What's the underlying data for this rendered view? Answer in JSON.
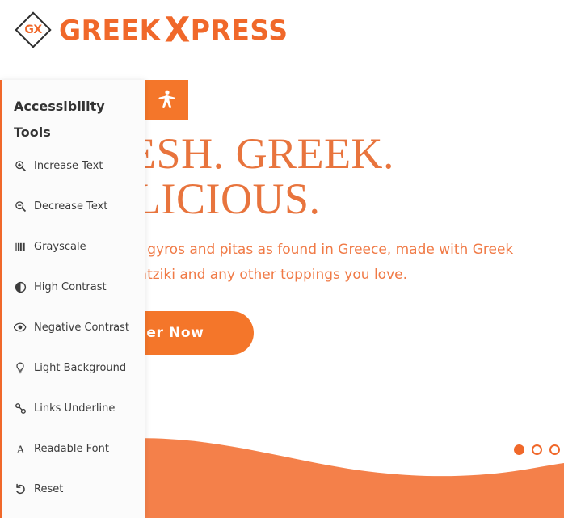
{
  "brand": {
    "logo_mark_text": "GX",
    "logo_word_1": "GREEK",
    "logo_word_2_x": "X",
    "logo_word_2_rest": "PRESS",
    "primary_color": "#f0682a",
    "button_color": "#f4762a",
    "heading_color": "#e8743d"
  },
  "hero": {
    "heading": "FRESH. GREEK.\nDELICIOUS.",
    "subtext": "Authentic gyros and pitas as found in Greece, made with Greek yogurt tzatziki and any other toppings you love.",
    "cta_label": "Order Now",
    "carousel": {
      "dots": [
        {
          "label": "slide-1",
          "active": true
        },
        {
          "label": "slide-2",
          "active": false
        },
        {
          "label": "slide-3",
          "active": false
        }
      ]
    }
  },
  "accessibility": {
    "toggle_icon": "accessibility-person-icon",
    "title": "Accessibility Tools",
    "items": [
      {
        "label": "Increase Text",
        "icon": "zoom-in-icon"
      },
      {
        "label": "Decrease Text",
        "icon": "zoom-out-icon"
      },
      {
        "label": "Grayscale",
        "icon": "grayscale-bars-icon"
      },
      {
        "label": "High Contrast",
        "icon": "contrast-circle-icon"
      },
      {
        "label": "Negative Contrast",
        "icon": "eye-icon"
      },
      {
        "label": "Light Background",
        "icon": "lightbulb-icon"
      },
      {
        "label": "Links Underline",
        "icon": "link-chain-icon"
      },
      {
        "label": "Readable Font",
        "icon": "serif-a-icon"
      },
      {
        "label": "Reset",
        "icon": "undo-arrow-icon"
      }
    ]
  }
}
